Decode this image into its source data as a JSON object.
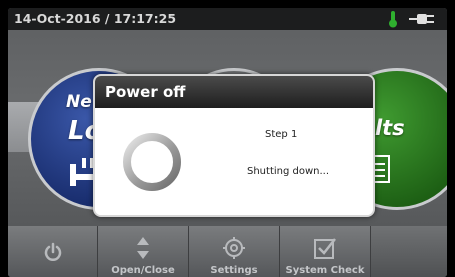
{
  "status_bar": {
    "datetime": "14-Oct-2016 / 17:17:25",
    "icons": [
      "thermometer-icon",
      "power-plug-icon"
    ]
  },
  "tiles": {
    "left_label_1": "Ne",
    "left_label_2": "Lo",
    "right_label": "ults"
  },
  "toolbar": {
    "power_icon": "power-icon",
    "open_close_label": "Open/Close",
    "settings_label": "Settings",
    "system_check_label": "System Check"
  },
  "dialog": {
    "title": "Power off",
    "step": "Step 1",
    "status": "Shutting down..."
  },
  "colors": {
    "status_bar": "#1c1d1e",
    "thermometer": "#2fb02f",
    "left_tile": "#1d3580",
    "right_tile": "#2a7a1e",
    "dialog_header": "#2d2d2d"
  }
}
